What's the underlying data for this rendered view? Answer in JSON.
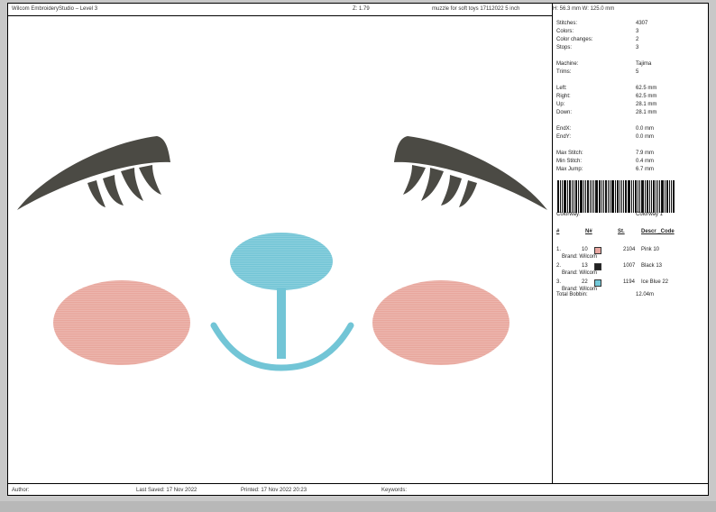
{
  "header": {
    "app_title": "Wilcom EmbroideryStudio – Level 3",
    "zoom": "Z: 1.79",
    "design_name": "muzzle for soft toys 17112022 5 inch",
    "size": "H: 56.3 mm   W: 125.0 mm"
  },
  "stats": [
    {
      "label": "Stitches:",
      "value": "4307"
    },
    {
      "label": "Colors:",
      "value": "3"
    },
    {
      "label": "Color changes:",
      "value": "2"
    },
    {
      "label": "Stops:",
      "value": "3"
    },
    {
      "label": "Machine:",
      "value": "Tajima"
    },
    {
      "label": "Trims:",
      "value": "5"
    },
    {
      "label": "Left:",
      "value": "62.5 mm"
    },
    {
      "label": "Right:",
      "value": "62.5 mm"
    },
    {
      "label": "Up:",
      "value": "28.1 mm"
    },
    {
      "label": "Down:",
      "value": "28.1 mm"
    },
    {
      "label": "EndX:",
      "value": "0.0 mm"
    },
    {
      "label": "EndY:",
      "value": "0.0 mm"
    },
    {
      "label": "Max Stitch:",
      "value": "7.9 mm"
    },
    {
      "label": "Min Stitch:",
      "value": "0.4 mm"
    },
    {
      "label": "Max Jump:",
      "value": "6.7 mm"
    }
  ],
  "colorway": {
    "label": "Colorway:",
    "value": "Colorway 1"
  },
  "colorway_table": {
    "headers": {
      "num": "#",
      "n": "N#",
      "st": "St.",
      "descr": "Descr _Code"
    },
    "rows": [
      {
        "num": "1.",
        "n": "10",
        "color": "#e8a6a0",
        "st": "2104",
        "descr": "Pink 10",
        "brand": "Brand: Wilcom"
      },
      {
        "num": "2.",
        "n": "13",
        "color": "#222222",
        "st": "1007",
        "descr": "Black 13",
        "brand": "Brand: Wilcom"
      },
      {
        "num": "3.",
        "n": "22",
        "color": "#72c8d8",
        "st": "1194",
        "descr": "Ice Blue 22",
        "brand": "Brand: Wilcom"
      }
    ],
    "total_label": "Total Bobbin:",
    "total_value": "12.04m"
  },
  "footer": {
    "author": "Author:",
    "last_saved": "Last Saved: 17 Nov 2022",
    "printed": "Printed: 17 Nov 2022 20:23",
    "keywords": "Keywords:"
  },
  "colors": {
    "eyelash": "#4b4a44",
    "cheek": "#e8a69c",
    "nose": "#72c5d6"
  }
}
